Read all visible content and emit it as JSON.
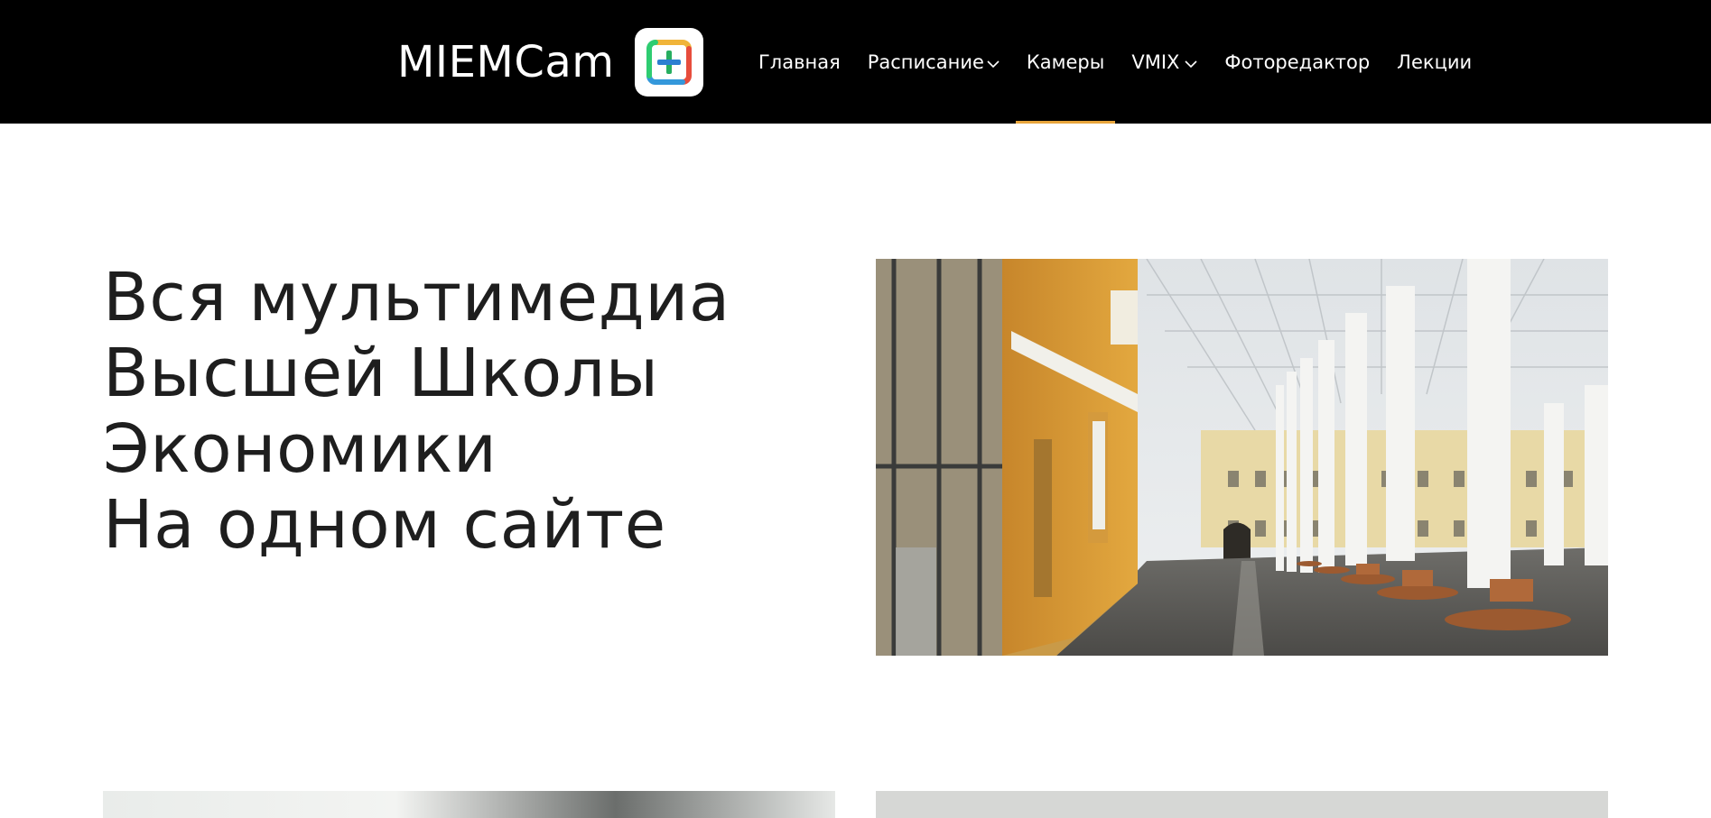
{
  "header": {
    "logo_text": "MIEMCam",
    "nav": [
      {
        "label": "Главная",
        "has_dropdown": false,
        "active": false
      },
      {
        "label": "Расписание",
        "has_dropdown": true,
        "active": false
      },
      {
        "label": "Камеры",
        "has_dropdown": false,
        "active": true
      },
      {
        "label": "VMIX",
        "has_dropdown": true,
        "active": false
      },
      {
        "label": "Фоторедактор",
        "has_dropdown": false,
        "active": false
      },
      {
        "label": "Лекции",
        "has_dropdown": false,
        "active": false
      }
    ]
  },
  "hero": {
    "lines": [
      "Вся мультимедиа",
      "Высшей Школы",
      "Экономики",
      "На одном сайте"
    ]
  },
  "colors": {
    "header_bg": "#000000",
    "active_underline": "#e8a53c",
    "title_text": "#1e1e1e"
  }
}
